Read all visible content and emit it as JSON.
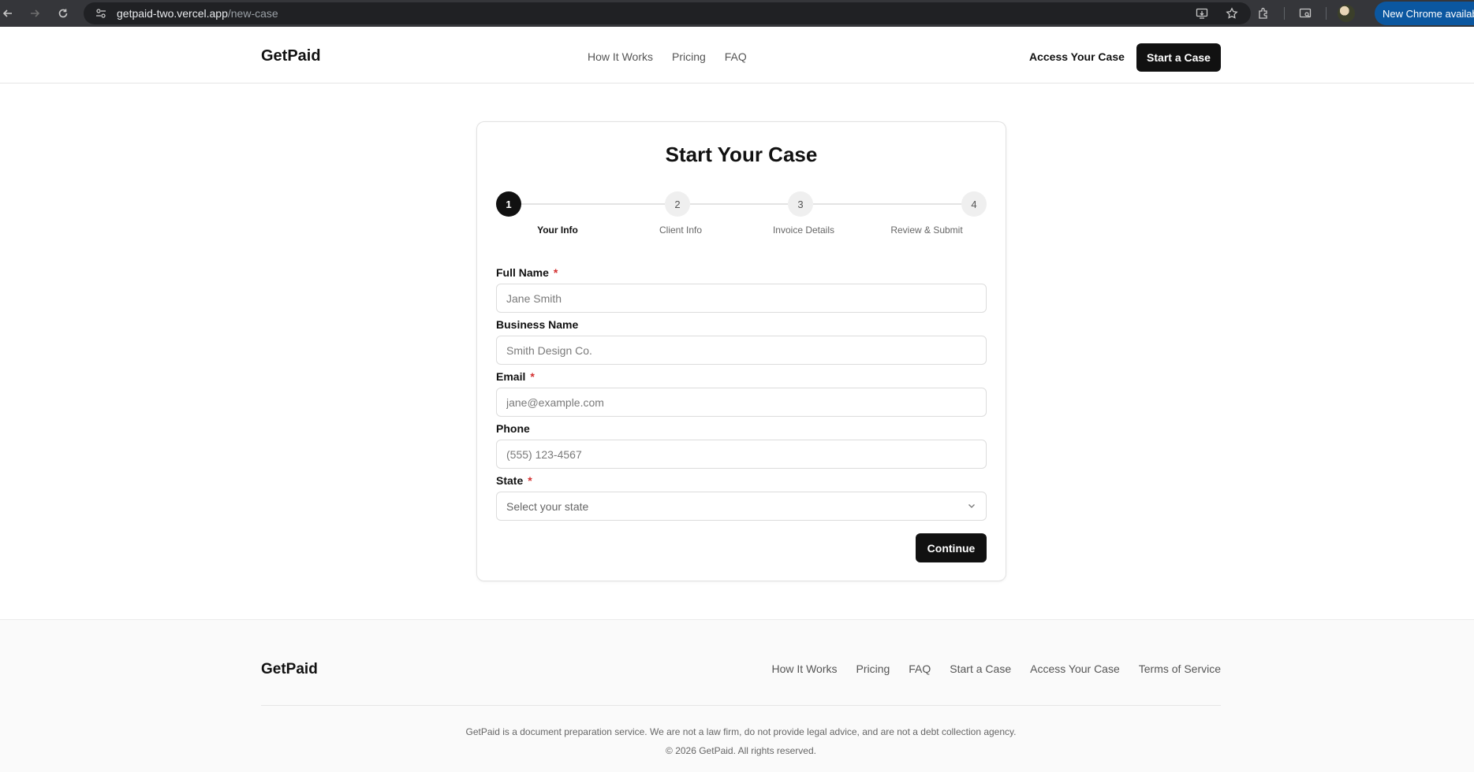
{
  "browser": {
    "url_host": "getpaid-two.vercel.app",
    "url_path": "/new-case",
    "update_label": "New Chrome available"
  },
  "header": {
    "brand": "GetPaid",
    "nav": [
      {
        "label": "How It Works"
      },
      {
        "label": "Pricing"
      },
      {
        "label": "FAQ"
      }
    ],
    "access_label": "Access Your Case",
    "start_label": "Start a Case"
  },
  "form": {
    "title": "Start Your Case",
    "steps": [
      {
        "number": "1",
        "label": "Your Info",
        "active": true
      },
      {
        "number": "2",
        "label": "Client Info",
        "active": false
      },
      {
        "number": "3",
        "label": "Invoice Details",
        "active": false
      },
      {
        "number": "4",
        "label": "Review & Submit",
        "active": false
      }
    ],
    "fields": {
      "full_name": {
        "label": "Full Name",
        "required": "*",
        "placeholder": "Jane Smith",
        "value": ""
      },
      "business_name": {
        "label": "Business Name",
        "placeholder": "Smith Design Co.",
        "value": ""
      },
      "email": {
        "label": "Email",
        "required": "*",
        "placeholder": "jane@example.com",
        "value": ""
      },
      "phone": {
        "label": "Phone",
        "placeholder": "(555) 123-4567",
        "value": ""
      },
      "state": {
        "label": "State",
        "required": "*",
        "selected": "Select your state"
      }
    },
    "continue_label": "Continue"
  },
  "footer": {
    "brand": "GetPaid",
    "links": [
      {
        "label": "How It Works"
      },
      {
        "label": "Pricing"
      },
      {
        "label": "FAQ"
      },
      {
        "label": "Start a Case"
      },
      {
        "label": "Access Your Case"
      },
      {
        "label": "Terms of Service"
      }
    ],
    "disclaimer": "GetPaid is a document preparation service. We are not a law firm, do not provide legal advice, and are not a debt collection agency.",
    "copyright": "© 2026 GetPaid. All rights reserved."
  },
  "colors": {
    "primary": "#111111",
    "required": "#d32f2f",
    "chrome_update": "#0b57a0"
  }
}
